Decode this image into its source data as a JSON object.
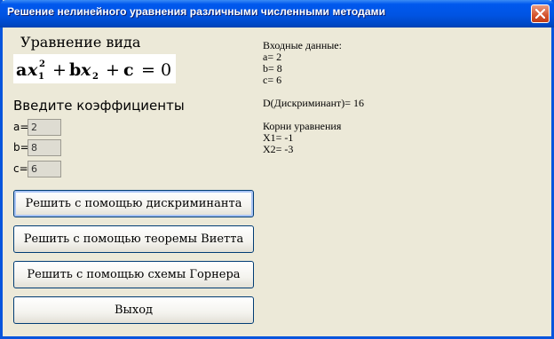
{
  "window": {
    "title": "Решение нелинейного уравнения различными численными методами",
    "close_icon": "close-icon"
  },
  "equation": {
    "title": "Уравнение вида",
    "formula_text": "a x1^2 + b x2 + c = 0"
  },
  "coefficients": {
    "title": "Введите коэффициенты",
    "a_label": "a=",
    "a_value": "2",
    "b_label": "b=",
    "b_value": "8",
    "c_label": "c=",
    "c_value": "6"
  },
  "buttons": {
    "discriminant": "Решить с помощью дискриминанта",
    "vieta": "Решить с помощью теоремы Виетта",
    "horner": "Решить с помощью схемы Горнера",
    "exit": "Выход"
  },
  "output": {
    "input_header": "Входные данные:",
    "a_line": "a= 2",
    "b_line": "b= 8",
    "c_line": "c= 6",
    "discriminant_line": "D(Дискриминант)= 16",
    "roots_header": "Корни уравнения",
    "x1_line": "X1= -1",
    "x2_line": "X2= -3"
  }
}
